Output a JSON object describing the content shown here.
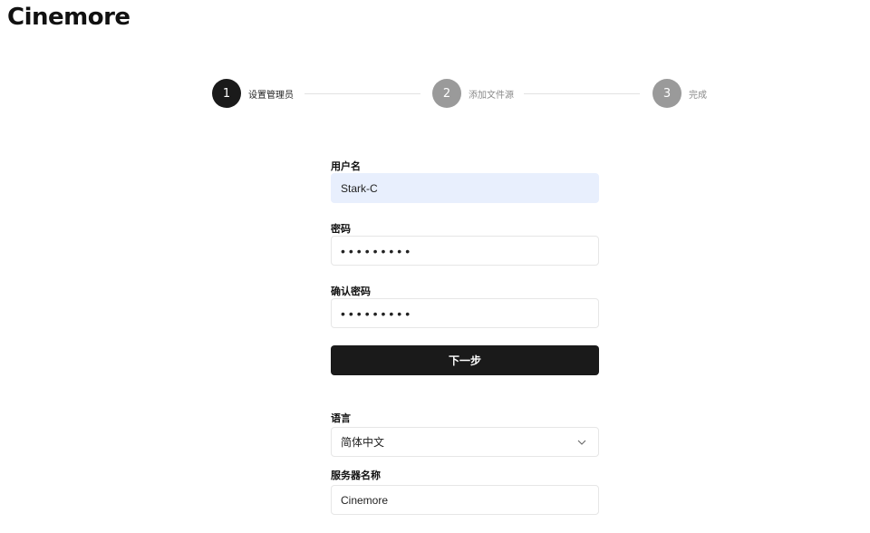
{
  "app": {
    "title": "Cinemore"
  },
  "stepper": {
    "steps": [
      {
        "number": "1",
        "label": "设置管理员",
        "state": "active"
      },
      {
        "number": "2",
        "label": "添加文件源",
        "state": "inactive"
      },
      {
        "number": "3",
        "label": "完成",
        "state": "inactive"
      }
    ]
  },
  "form": {
    "username": {
      "label": "用户名",
      "value": "Stark-C"
    },
    "password": {
      "label": "密码",
      "value": "•••••••••"
    },
    "confirm_password": {
      "label": "确认密码",
      "value": "•••••••••"
    },
    "next_button": "下一步"
  },
  "settings": {
    "language": {
      "label": "语言",
      "selected": "简体中文"
    },
    "server_name": {
      "label": "服务器名称",
      "value": "Cinemore"
    }
  },
  "colors": {
    "active_step": "#1a1a1a",
    "inactive_step": "#9a9a9a",
    "autofill_bg": "#e8effd",
    "primary_button": "#1a1a1a"
  }
}
